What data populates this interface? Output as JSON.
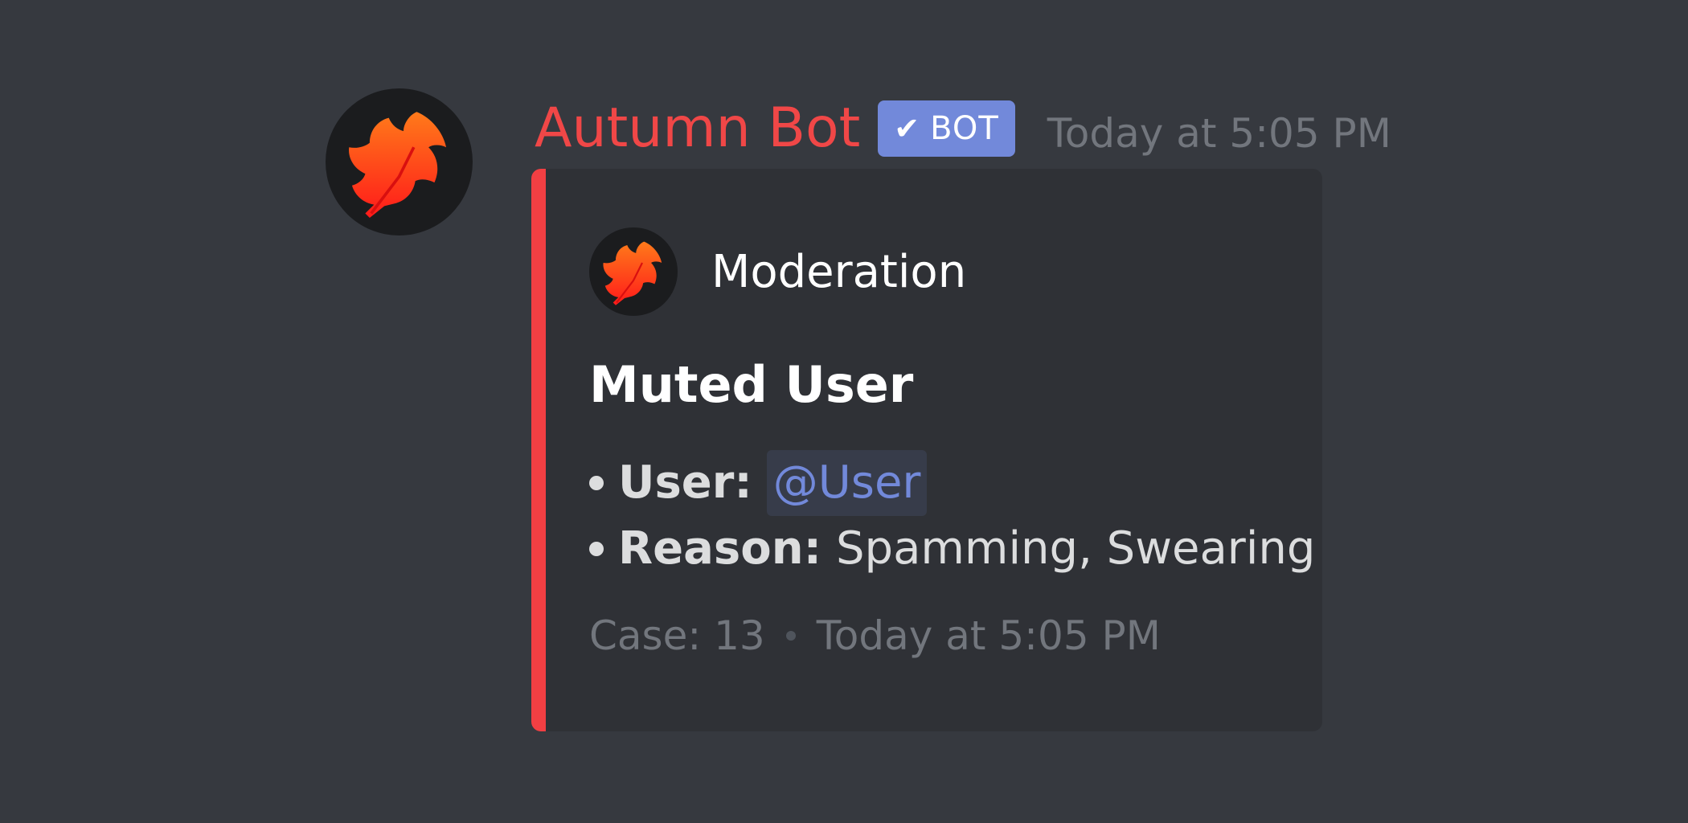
{
  "message": {
    "author": "Autumn Bot",
    "bot_tag": {
      "check": "✔",
      "label": "BOT"
    },
    "timestamp": "Today at 5:05 PM",
    "avatar_icon": "maple-leaf-icon"
  },
  "embed": {
    "accent_color": "#f23f43",
    "author_name": "Moderation",
    "author_icon": "maple-leaf-icon",
    "title": "Muted User",
    "fields": [
      {
        "name": "User:",
        "value": "@User",
        "is_mention": true
      },
      {
        "name": "Reason:",
        "value": "Spamming, Swearing",
        "is_mention": false
      }
    ],
    "footer": {
      "text": "Case: 13",
      "timestamp": "Today at 5:05 PM"
    }
  },
  "colors": {
    "background": "#36393f",
    "embed_background": "#2f3136",
    "username": "#f04747",
    "bot_tag": "#7289da",
    "mention": "#7289da"
  }
}
